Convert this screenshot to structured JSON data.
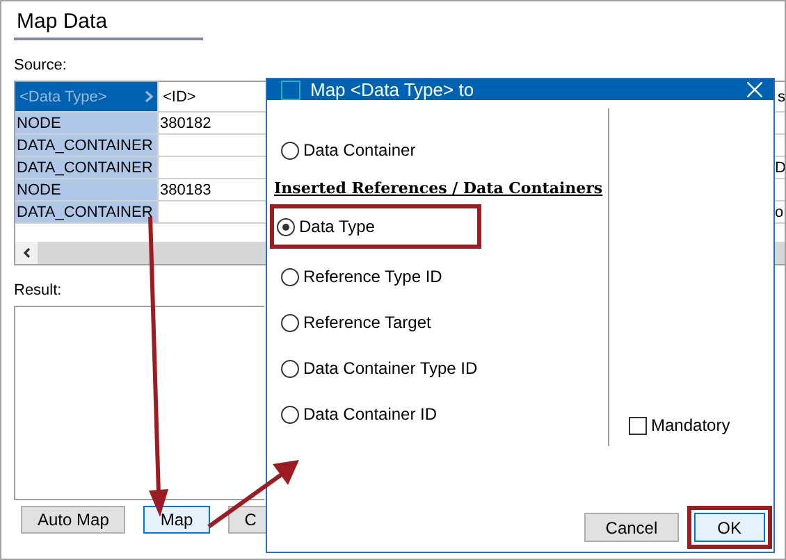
{
  "window": {
    "title": "Map Data"
  },
  "source": {
    "label": "Source:",
    "columns": [
      {
        "label": "<Data Type>",
        "selected": true
      },
      {
        "label": "<ID>",
        "selected": false
      },
      {
        "label": "s",
        "selected": false
      }
    ],
    "rows": [
      [
        "NODE",
        "380182",
        ""
      ],
      [
        "DATA_CONTAINER",
        "",
        ""
      ],
      [
        "DATA_CONTAINER",
        "",
        "D"
      ],
      [
        "NODE",
        "380183",
        ""
      ],
      [
        "DATA_CONTAINER",
        "",
        "o"
      ]
    ]
  },
  "result": {
    "label": "Result:"
  },
  "buttons": [
    {
      "label": "Auto Map",
      "focused": false
    },
    {
      "label": "Map",
      "focused": true
    },
    {
      "label": "C",
      "focused": false
    }
  ],
  "dialog": {
    "title": "Map <Data Type> to",
    "options": [
      {
        "label": "Data Container",
        "selected": false,
        "highlighted": false
      }
    ],
    "section_heading": "Inserted References / Data Containers",
    "section_options": [
      {
        "label": "Data Type",
        "selected": true,
        "highlighted": true
      },
      {
        "label": "Reference Type ID",
        "selected": false,
        "highlighted": false
      },
      {
        "label": "Reference Target",
        "selected": false,
        "highlighted": false
      },
      {
        "label": "Data Container Type ID",
        "selected": false,
        "highlighted": false
      },
      {
        "label": "Data Container ID",
        "selected": false,
        "highlighted": false
      }
    ],
    "mandatory": {
      "label": "Mandatory",
      "checked": false
    },
    "buttons": [
      {
        "label": "Cancel",
        "default": false,
        "highlighted": false
      },
      {
        "label": "OK",
        "default": true,
        "highlighted": true
      }
    ]
  }
}
